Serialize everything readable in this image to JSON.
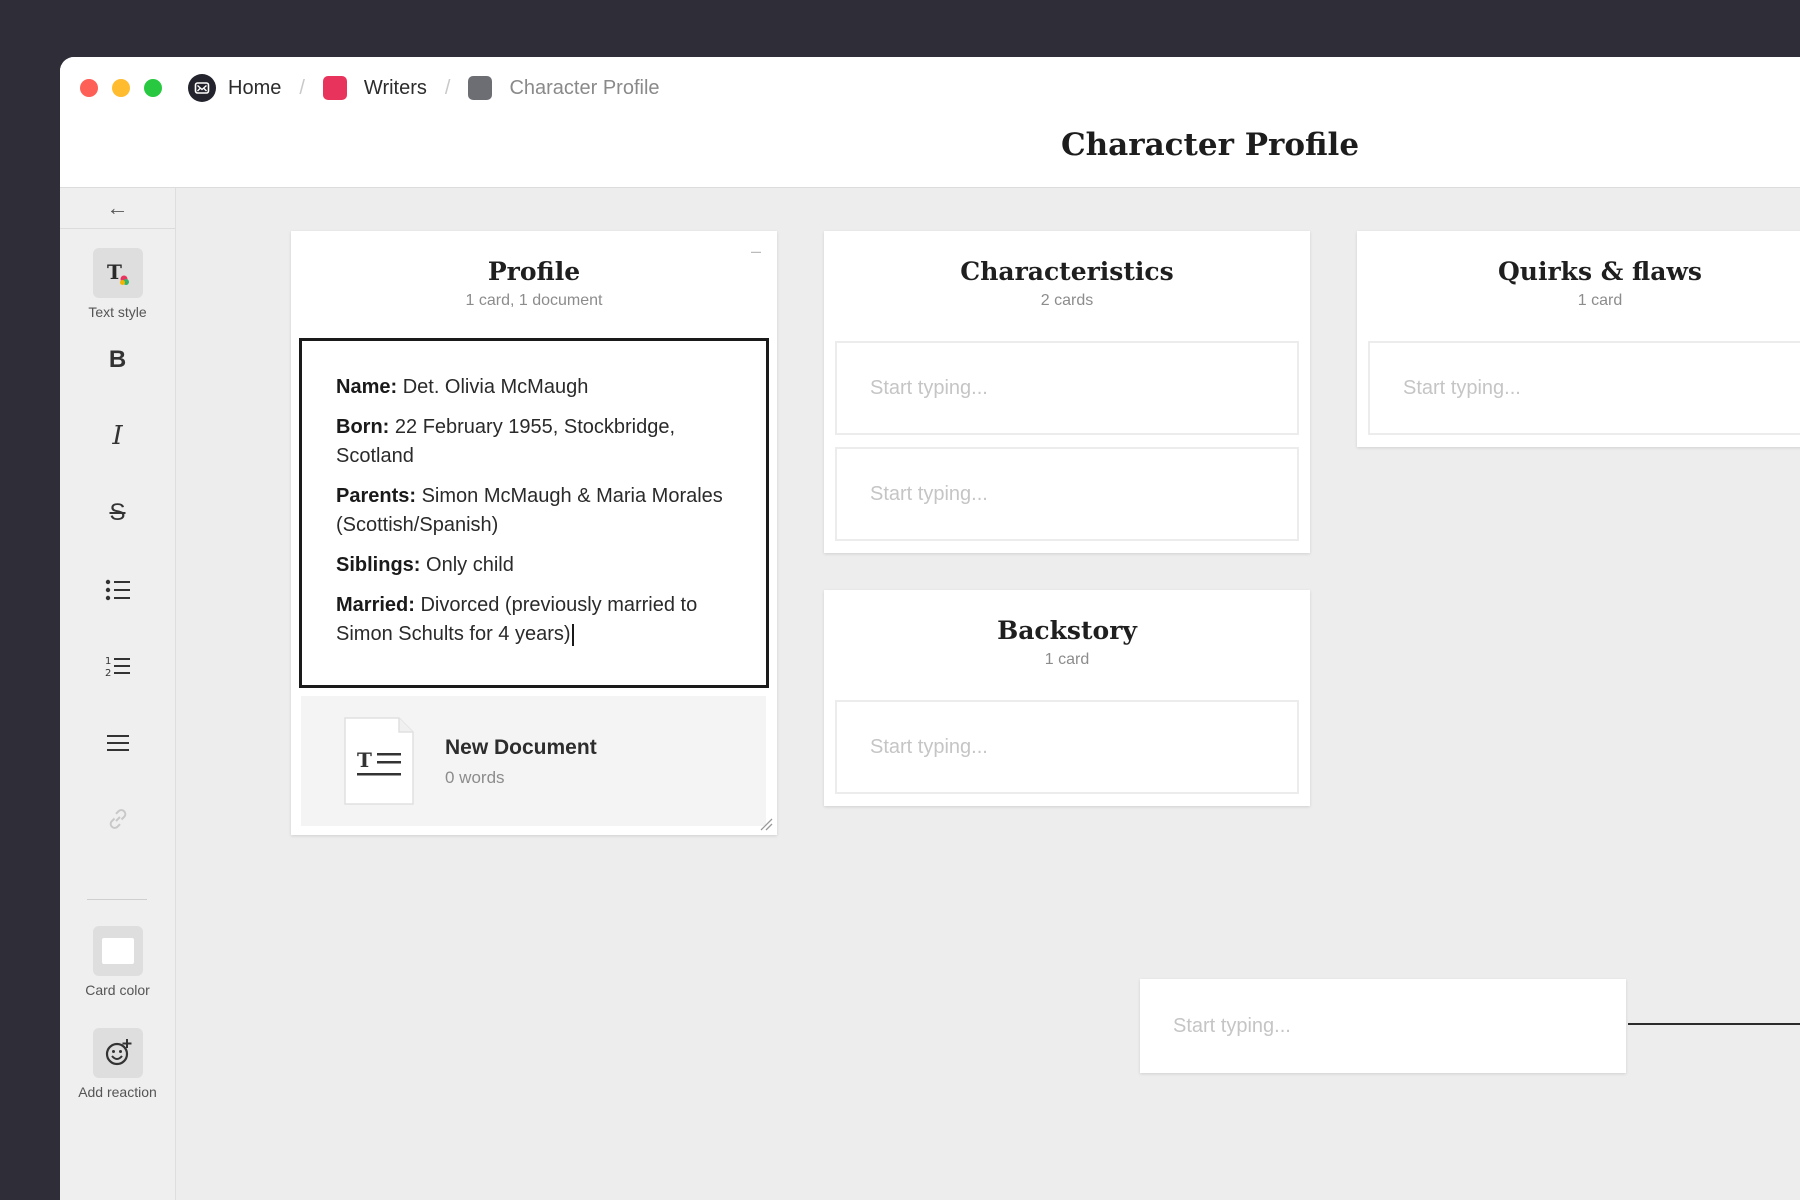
{
  "breadcrumb": {
    "home": "Home",
    "writers": "Writers",
    "current": "Character Profile",
    "separator": "/"
  },
  "page_title": "Character Profile",
  "toolbar": {
    "text_style_label": "Text style",
    "bold_glyph": "B",
    "italic_glyph": "I",
    "strike_glyph": "S",
    "card_color_label": "Card color",
    "add_reaction_label": "Add reaction"
  },
  "columns": {
    "profile": {
      "title": "Profile",
      "count": "1 card, 1 document",
      "card": {
        "name_label": "Name:",
        "name_value": " Det. Olivia McMaugh",
        "born_label": "Born:",
        "born_value": " 22 February 1955, Stockbridge, Scotland",
        "parents_label": "Parents:",
        "parents_value": " Simon McMaugh & Maria Morales (Scottish/Spanish)",
        "siblings_label": "Siblings:",
        "siblings_value": " Only child",
        "married_label": "Married:",
        "married_value": " Divorced (previously married to Simon Schults for 4 years)"
      },
      "document": {
        "title": "New Document",
        "words": "0 words"
      }
    },
    "characteristics": {
      "title": "Characteristics",
      "count": "2 cards",
      "cards": [
        "Start typing...",
        "Start typing..."
      ]
    },
    "quirks": {
      "title": "Quirks & flaws",
      "count": "1 card",
      "cards": [
        "Start typing..."
      ]
    },
    "backstory": {
      "title": "Backstory",
      "count": "1 card",
      "cards": [
        "Start typing..."
      ]
    }
  },
  "loose_card": {
    "placeholder": "Start typing..."
  },
  "colors": {
    "close": "#fe5f57",
    "minimize": "#febc2e",
    "zoom": "#28c840",
    "writers_accent": "#e8345c",
    "page_icon": "#6d6e73"
  }
}
